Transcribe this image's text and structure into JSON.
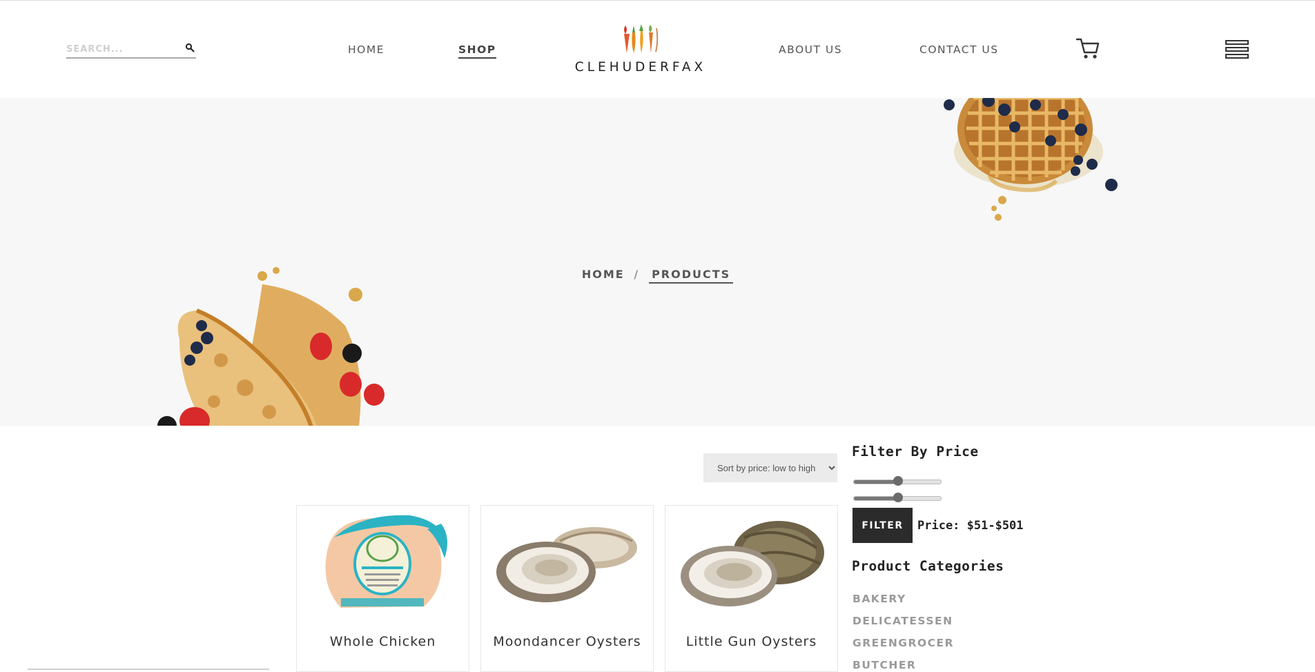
{
  "header": {
    "search_placeholder": "SEARCH...",
    "nav": [
      "HOME",
      "SHOP",
      "ABOUT US",
      "CONTACT US"
    ],
    "active_nav": "SHOP",
    "logo_text": "CLEHUDERFAX"
  },
  "breadcrumb": {
    "home": "HOME",
    "separator": "/",
    "current": "PRODUCTS"
  },
  "shop": {
    "sort_options": [
      "Sort by price: low to high"
    ],
    "sort_selected": "Sort by price: low to high",
    "products": [
      {
        "name": "Whole Chicken",
        "image": "whole-chicken"
      },
      {
        "name": "Moondancer Oysters",
        "image": "oysters"
      },
      {
        "name": "Little Gun Oysters",
        "image": "oysters"
      }
    ]
  },
  "sidebar": {
    "filter_heading": "Filter By Price",
    "filter_button": "FILTER",
    "price_range": "Price: $51-$501",
    "price_min_slider_value": 51,
    "price_max_slider_value": 501,
    "categories_heading": "Product Categories",
    "categories": [
      "BAKERY",
      "DELICATESSEN",
      "GREENGROCER",
      "BUTCHER"
    ]
  },
  "colors": {
    "hero_bg": "#f7f7f7",
    "button_dark": "#2b2b2b",
    "category_grey": "#9a9a9a",
    "text_dark": "#222222"
  },
  "icons": [
    "search-icon",
    "cart-icon",
    "hamburger-menu-icon",
    "logo-vegetables-icon"
  ]
}
